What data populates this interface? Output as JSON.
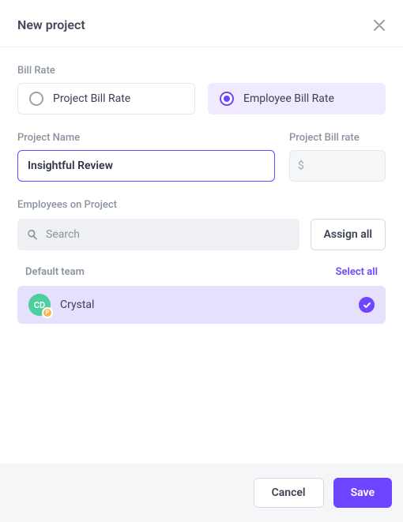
{
  "header": {
    "title": "New project"
  },
  "bill_rate": {
    "label": "Bill Rate",
    "options": {
      "project": "Project Bill Rate",
      "employee": "Employee Bill Rate"
    },
    "selected": "employee"
  },
  "project_name": {
    "label": "Project Name",
    "value": "Insightful Review"
  },
  "project_bill_rate": {
    "label": "Project Bill rate",
    "currency_symbol": "$",
    "value": ""
  },
  "employees": {
    "label": "Employees on Project",
    "search_placeholder": "Search",
    "assign_all_label": "Assign all"
  },
  "team": {
    "name": "Default team",
    "select_all_label": "Select all",
    "members": [
      {
        "initials": "CD",
        "badge": "P",
        "name": "Crystal",
        "selected": true
      }
    ]
  },
  "footer": {
    "cancel": "Cancel",
    "save": "Save"
  },
  "colors": {
    "accent": "#6d44ff",
    "selected_bg": "#efeaff",
    "member_bg": "#e5e0fb",
    "avatar_bg": "#4bcf9e",
    "badge_bg": "#ffb44a"
  }
}
